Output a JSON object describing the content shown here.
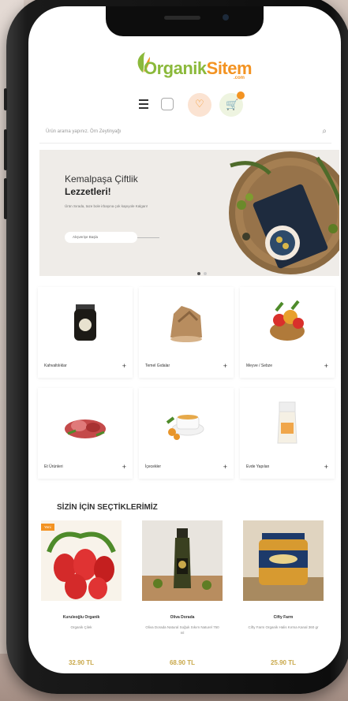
{
  "brand": {
    "primary": "Organik",
    "secondary": "Sitem",
    "tld": ".com"
  },
  "search": {
    "placeholder": "Ürün arama yapınız. Örn Zeytinyağı"
  },
  "hero": {
    "line1": "Kemalpaşa Çiftlik",
    "line2": "Lezzetleri!",
    "description": "Ürün Sırada, taze bole irbaşına çok kapıyole Kalgarı!",
    "button": "Alışverişe Başla"
  },
  "categories": [
    {
      "label": "Kahvaltılıklar",
      "icon": "jar-icon"
    },
    {
      "label": "Temel Gıdalar",
      "icon": "sack-icon"
    },
    {
      "label": "Meyve / Sebze",
      "icon": "basket-icon"
    },
    {
      "label": "Et Ürünleri",
      "icon": "meat-icon"
    },
    {
      "label": "İçecekler",
      "icon": "tea-icon"
    },
    {
      "label": "Evde Yapılan",
      "icon": "tube-icon"
    }
  ],
  "section_title": "SİZİN İÇİN SEÇTİKLERİMİZ",
  "products": [
    {
      "badge": "Yeni",
      "brand": "Kuruleoğlu Organik",
      "name": "Organik Çilek",
      "price": "32.90 TL"
    },
    {
      "brand": "Oliva Dorada",
      "name": "Oliva Dorada Natural Soğuk Sıkım Naturel 750 ml",
      "price": "68.90 TL"
    },
    {
      "brand": "Cifty Farm",
      "name": "Cifty Farm Organik Halis Kırma Kanal 360 gr",
      "price": "25.90 TL"
    }
  ],
  "colors": {
    "green": "#8bb93b",
    "orange": "#f39322",
    "price": "#c9a84a"
  }
}
